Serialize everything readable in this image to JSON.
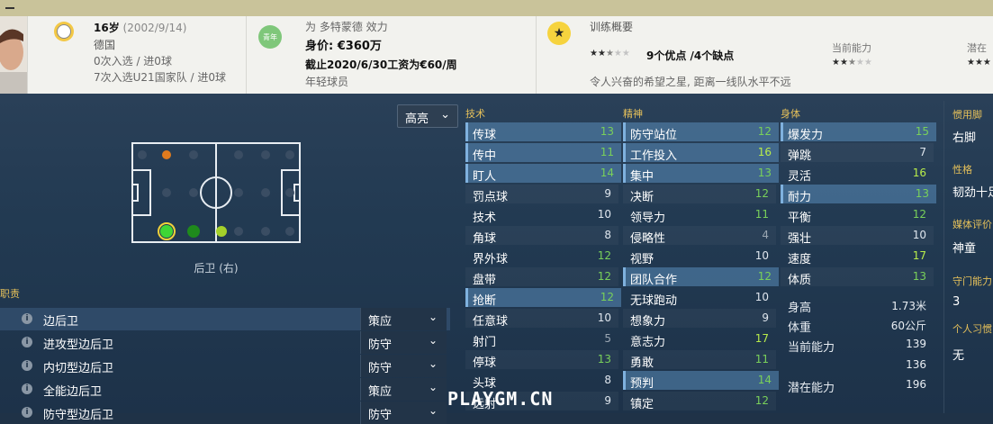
{
  "header": {
    "age": "16岁",
    "dob": "(2002/9/14)",
    "nation": "德国",
    "caps": "0次入选 / 进0球",
    "u21_caps": "7次入选U21国家队 / 进0球",
    "youth_badge": "青年",
    "club_line": "为 多特蒙德 效力",
    "value": "身价: €360万",
    "contract": "截止2020/6/30工资为€60/周",
    "squad_status": "年轻球员",
    "training_title": "训练概要",
    "training_summary": "9个优点 /4个缺点",
    "training_note": "令人兴奋的希望之星, 距离一线队水平不远",
    "current_ability_label": "当前能力",
    "potential_label": "潜在",
    "training_stars": 2.5,
    "current_stars": 2.5
  },
  "highlight_select": "高亮",
  "pitch": {
    "label": "后卫 (右)"
  },
  "roles": {
    "title": "职责",
    "items": [
      {
        "name": "边后卫",
        "duty": "策应"
      },
      {
        "name": "进攻型边后卫",
        "duty": "防守"
      },
      {
        "name": "内切型边后卫",
        "duty": "防守"
      },
      {
        "name": "全能边后卫",
        "duty": "策应"
      },
      {
        "name": "防守型边后卫",
        "duty": "防守"
      }
    ]
  },
  "technical": {
    "title": "技术",
    "items": [
      {
        "label": "传球",
        "value": "13"
      },
      {
        "label": "传中",
        "value": "11"
      },
      {
        "label": "盯人",
        "value": "14"
      },
      {
        "label": "罚点球",
        "value": "9"
      },
      {
        "label": "技术",
        "value": "10"
      },
      {
        "label": "角球",
        "value": "8"
      },
      {
        "label": "界外球",
        "value": "12"
      },
      {
        "label": "盘带",
        "value": "12"
      },
      {
        "label": "抢断",
        "value": "12"
      },
      {
        "label": "任意球",
        "value": "10"
      },
      {
        "label": "射门",
        "value": "5"
      },
      {
        "label": "停球",
        "value": "13"
      },
      {
        "label": "头球",
        "value": "8"
      },
      {
        "label": "远射",
        "value": "9"
      }
    ]
  },
  "mental": {
    "title": "精神",
    "items": [
      {
        "label": "防守站位",
        "value": "12"
      },
      {
        "label": "工作投入",
        "value": "16"
      },
      {
        "label": "集中",
        "value": "13"
      },
      {
        "label": "决断",
        "value": "12"
      },
      {
        "label": "领导力",
        "value": "11"
      },
      {
        "label": "侵略性",
        "value": "4"
      },
      {
        "label": "视野",
        "value": "10"
      },
      {
        "label": "团队合作",
        "value": "12"
      },
      {
        "label": "无球跑动",
        "value": "10"
      },
      {
        "label": "想象力",
        "value": "9"
      },
      {
        "label": "意志力",
        "value": "17"
      },
      {
        "label": "勇敢",
        "value": "11"
      },
      {
        "label": "预判",
        "value": "14"
      },
      {
        "label": "镇定",
        "value": "12"
      }
    ]
  },
  "physical": {
    "title": "身体",
    "items": [
      {
        "label": "爆发力",
        "value": "15"
      },
      {
        "label": "弹跳",
        "value": "7"
      },
      {
        "label": "灵活",
        "value": "16"
      },
      {
        "label": "耐力",
        "value": "13"
      },
      {
        "label": "平衡",
        "value": "12"
      },
      {
        "label": "强壮",
        "value": "10"
      },
      {
        "label": "速度",
        "value": "17"
      },
      {
        "label": "体质",
        "value": "13"
      }
    ],
    "height_label": "身高",
    "height": "1.73米",
    "weight_label": "体重",
    "weight": "60公斤",
    "ca_label": "当前能力",
    "ca": "139",
    "ca2": "136",
    "pa_label": "潜在能力",
    "pa": "196"
  },
  "side": {
    "foot_label": "惯用脚",
    "foot": "右脚",
    "personality_label": "性格",
    "personality": "韧劲十足",
    "media_label": "媒体评价",
    "media": "神童",
    "gk_label": "守门能力",
    "gk": "3",
    "habits_label": "个人习惯",
    "habits": "无"
  },
  "watermark": "PLAYGM.CN",
  "colors": {
    "highlight_row": "#5a8cb9",
    "header_bg": "#f2f2ee",
    "attr_heading": "#e6c15a"
  }
}
